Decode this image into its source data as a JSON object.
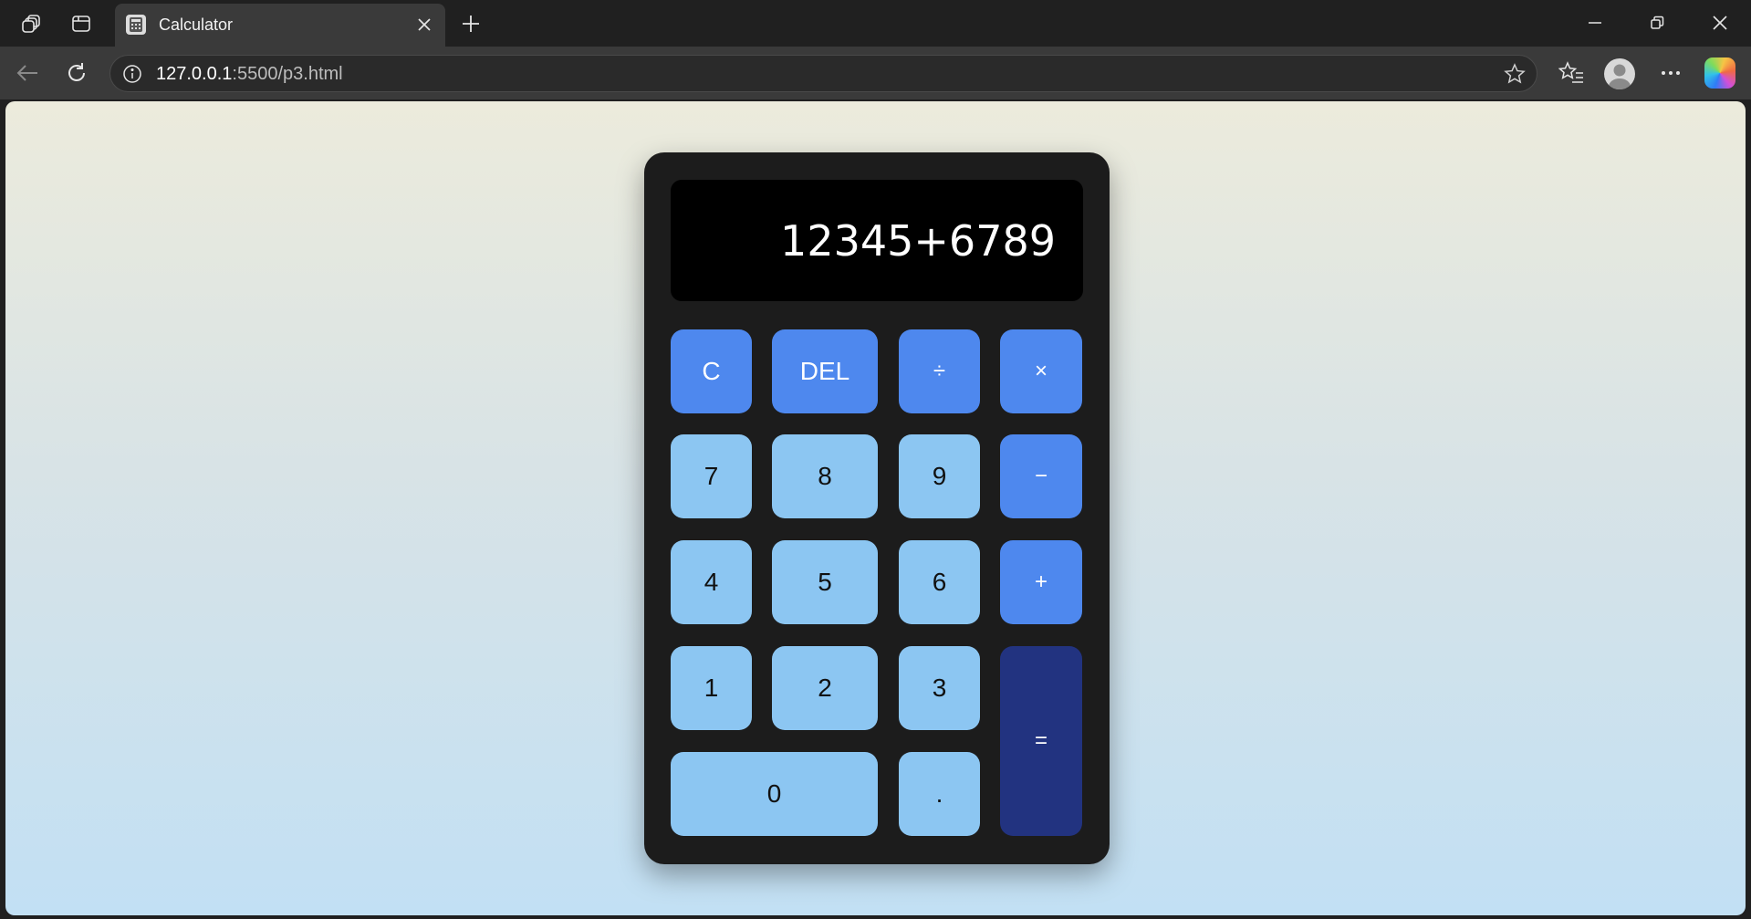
{
  "browser": {
    "tab_title": "Calculator",
    "url_host": "127.0.0.1",
    "url_rest": ":5500/p3.html"
  },
  "calculator": {
    "display": "12345+6789",
    "keys": {
      "clear": "C",
      "delete": "DEL",
      "divide": "÷",
      "multiply": "×",
      "seven": "7",
      "eight": "8",
      "nine": "9",
      "minus": "−",
      "four": "4",
      "five": "5",
      "six": "6",
      "plus": "+",
      "one": "1",
      "two": "2",
      "three": "3",
      "equals": "=",
      "zero": "0",
      "decimal": "."
    }
  },
  "colors": {
    "operator_key": "#4e88ee",
    "number_key": "#8cc6f2",
    "equals_key": "#223380",
    "calculator_body": "#1c1c1c",
    "display_bg": "#000000"
  }
}
